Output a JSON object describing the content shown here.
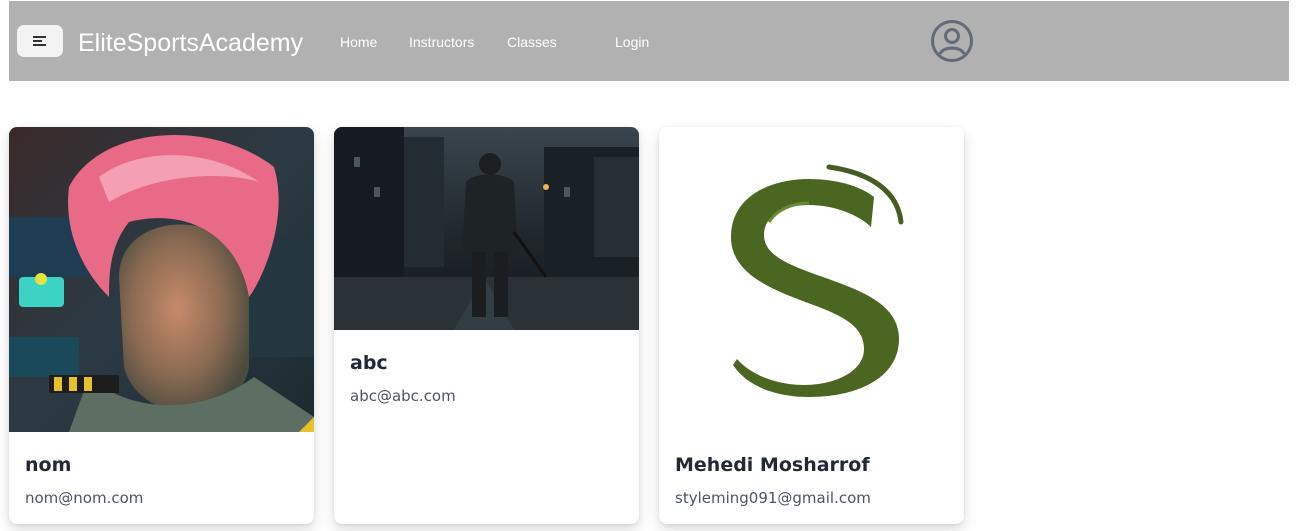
{
  "navbar": {
    "brand": "EliteSportsAcademy",
    "links": [
      {
        "label": "Home"
      },
      {
        "label": "Instructors"
      },
      {
        "label": "Classes"
      },
      {
        "label": "Login"
      }
    ],
    "menu_icon": "menu-icon",
    "avatar_icon": "user-circle-icon",
    "background": "#b1b1b1"
  },
  "instructors": [
    {
      "name": "nom",
      "email": "nom@nom.com"
    },
    {
      "name": "abc",
      "email": "abc@abc.com"
    },
    {
      "name": "Mehedi Mosharrof",
      "email": "styleming091@gmail.com"
    }
  ]
}
